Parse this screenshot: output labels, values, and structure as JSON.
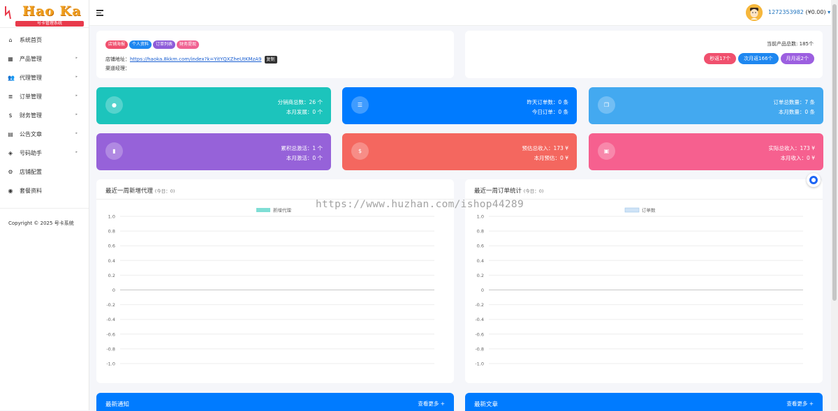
{
  "logo": {
    "brand": "Hao Ka",
    "sub": "号卡管理系统"
  },
  "sidebar": {
    "items": [
      {
        "label": "系统首页",
        "icon": "home-icon",
        "glyph": "⌂",
        "arrow": false
      },
      {
        "label": "产品管理",
        "icon": "grid-icon",
        "glyph": "▦",
        "arrow": true
      },
      {
        "label": "代理管理",
        "icon": "users-icon",
        "glyph": "👥",
        "arrow": true
      },
      {
        "label": "订单管理",
        "icon": "list-icon",
        "glyph": "≣",
        "arrow": true
      },
      {
        "label": "财务管理",
        "icon": "money-icon",
        "glyph": "$",
        "arrow": true
      },
      {
        "label": "公告文章",
        "icon": "newspaper-icon",
        "glyph": "▤",
        "arrow": true
      },
      {
        "label": "号码助手",
        "icon": "shield-icon",
        "glyph": "◈",
        "arrow": true
      },
      {
        "label": "店铺配置",
        "icon": "user-cog-icon",
        "glyph": "⚙",
        "arrow": false
      },
      {
        "label": "套餐资料",
        "icon": "compass-icon",
        "glyph": "◉",
        "arrow": false
      }
    ],
    "copyright": "Copyright © 2025 号卡系统"
  },
  "topbar": {
    "username": "1272353982",
    "balance": "(¥0.00)",
    "caret": "▾"
  },
  "shop": {
    "tags": [
      {
        "label": "店铺海报",
        "color": "#f0506e"
      },
      {
        "label": "个人资料",
        "color": "#1e87f0"
      },
      {
        "label": "订单列表",
        "color": "#8e5cd9"
      },
      {
        "label": "财务提现",
        "color": "#f06292"
      }
    ],
    "address_label": "店铺地址：",
    "address_url": "https://haoka.8kkm.com/index?k=YitYQXZheUtKMzA9",
    "copy_label": "复制",
    "manager_label": "渠道经理："
  },
  "products": {
    "total_label": "当前产品总数: 185个",
    "pills": [
      {
        "label": "秒返17个",
        "color": "#f0506e"
      },
      {
        "label": "次月返166个",
        "color": "#1e87f0"
      },
      {
        "label": "月月返2个",
        "color": "#9c5fe0"
      }
    ]
  },
  "stats": [
    {
      "line1": "分销商总数：26 个",
      "line2": "本月发展：0 个",
      "color": "#1cc4bc",
      "icon": "user-icon",
      "glyph": "●"
    },
    {
      "line1": "昨天订单数：0 条",
      "line2": "今日订单：0 条",
      "color": "#007bff",
      "icon": "list-icon",
      "glyph": "☰"
    },
    {
      "line1": "订单总数量：7 条",
      "line2": "本月数量：0 条",
      "color": "#43a9f0",
      "icon": "copy-icon",
      "glyph": "❐"
    },
    {
      "line1": "累积总激活：1 个",
      "line2": "本月激活：0 个",
      "color": "#9662d9",
      "icon": "book-icon",
      "glyph": "▮"
    },
    {
      "line1": "预估总收入：173 ¥",
      "line2": "本月预估：0 ¥",
      "color": "#f4675f",
      "icon": "dollar-icon",
      "glyph": "$"
    },
    {
      "line1": "实际总收入：173 ¥",
      "line2": "本月收入：0 ¥",
      "color": "#f6608f",
      "icon": "cards-icon",
      "glyph": "▣"
    }
  ],
  "charts": {
    "left": {
      "title": "最近一周新增代理",
      "today": "(今日：0)"
    },
    "right": {
      "title": "最近一周订单统计",
      "today": "(今日：0)"
    }
  },
  "chart_data": [
    {
      "type": "line",
      "title": "最近一周新增代理",
      "series": [
        {
          "name": "新增代理",
          "values": [],
          "color": "#7fded5"
        }
      ],
      "yticks": [
        "1.0",
        "0.8",
        "0.6",
        "0.4",
        "0.2",
        "0",
        "-0.2",
        "-0.4",
        "-0.6",
        "-0.8",
        "-1.0"
      ],
      "ylim": [
        -1.0,
        1.0
      ],
      "grid": true,
      "legend": "top-center"
    },
    {
      "type": "line",
      "title": "最近一周订单统计",
      "series": [
        {
          "name": "订单数",
          "values": [],
          "color": "#cfe3f7"
        }
      ],
      "yticks": [
        "1.0",
        "0.8",
        "0.6",
        "0.4",
        "0.2",
        "0",
        "-0.2",
        "-0.4",
        "-0.6",
        "-0.8",
        "-1.0"
      ],
      "ylim": [
        -1.0,
        1.0
      ],
      "grid": true,
      "legend": "top-center"
    }
  ],
  "notice": {
    "title": "最新通知",
    "more": "查看更多 +"
  },
  "articles": {
    "title": "最新文章",
    "more": "查看更多 +"
  },
  "watermark": "https://www.huzhan.com/ishop44289"
}
